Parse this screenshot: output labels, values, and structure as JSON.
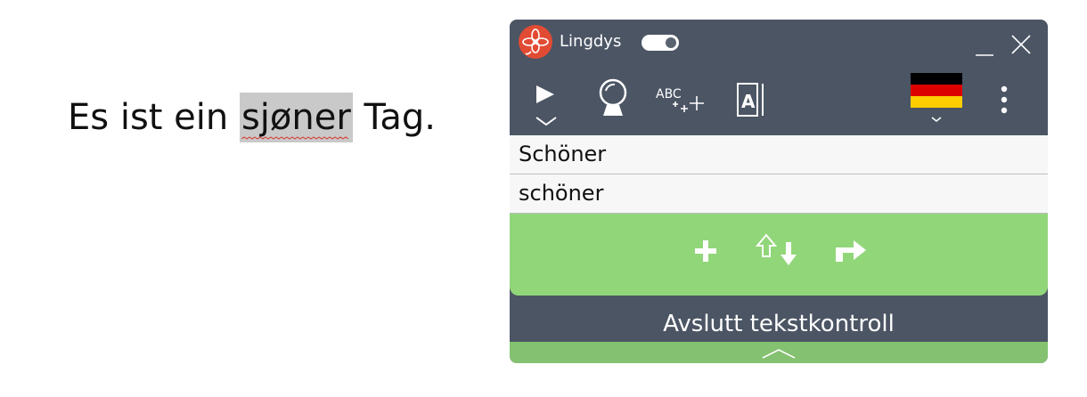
{
  "document": {
    "before": "Es ist ein ",
    "misspelled": "sjøner",
    "after": " Tag."
  },
  "panel": {
    "app_name": "Lingdys",
    "toggle_on": true,
    "suggestions": [
      "Schöner",
      "schöner"
    ],
    "finish_label": "Avslutt tekstkontroll"
  },
  "icons": {
    "logo": "lingdys-flower-logo",
    "minimize": "minimize-icon",
    "close": "close-icon",
    "play": "play-icon",
    "predict": "word-prediction-icon",
    "spellcheck": "spellcheck-icon",
    "dictionary": "dictionary-icon",
    "language": "german-flag-icon",
    "more": "more-vertical-icon",
    "add": "plus-icon",
    "swap_case": "swap-case-icon",
    "skip": "skip-arrow-icon",
    "collapse": "chevron-up-icon"
  },
  "colors": {
    "panel_bg": "#4b5564",
    "action_green": "#92d67a",
    "collapse_green": "#84c170",
    "logo_red": "#e24b33",
    "highlight": "#c9c9c9",
    "squiggle": "#d9342b"
  }
}
